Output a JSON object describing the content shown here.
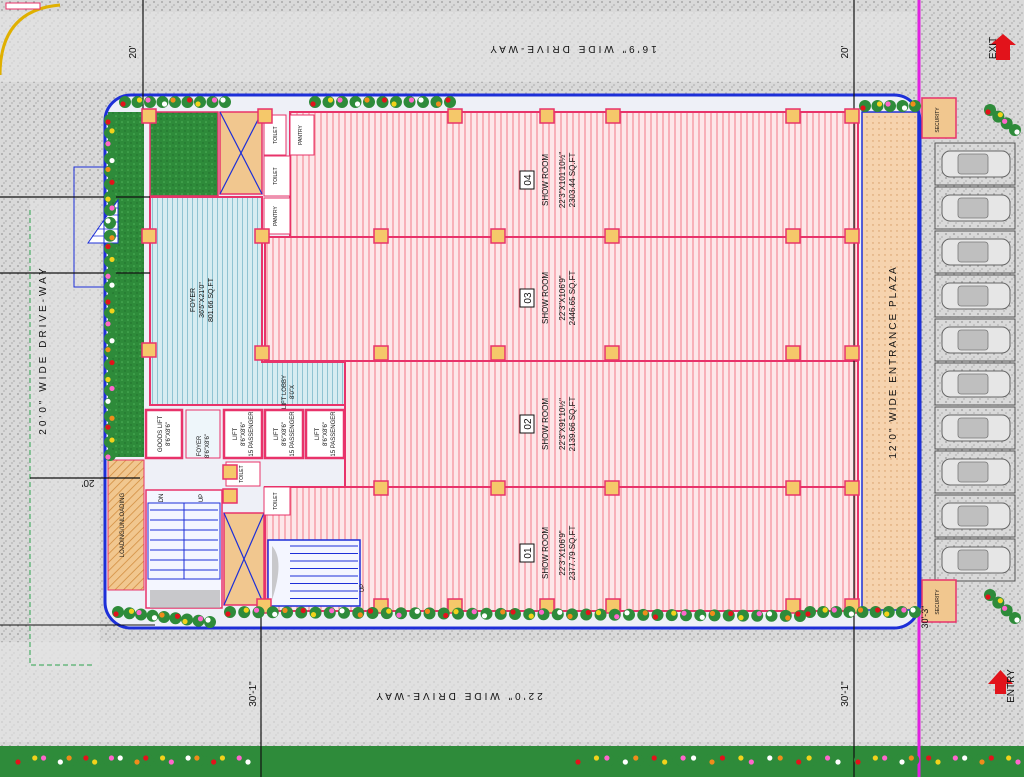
{
  "drive_way_top": "16'9\" WIDE DRIVE-WAY",
  "drive_way_bottom": "22'0\" WIDE DRIVE-WAY",
  "drive_way_left": "20'0\" WIDE DRIVE-WAY",
  "plaza": "12'0\" WIDE ENTRANCE PLAZA",
  "exit": "EXIT",
  "entry": "ENTRY",
  "dims": {
    "top_left": "20'",
    "top_right": "20'",
    "left_mid": "20'",
    "bottom_left": "30'-1\"",
    "bottom_right": "30'-1\"",
    "bottom_far_right": "30'-3\""
  },
  "showrooms": [
    {
      "num": "04",
      "name": "SHOW ROOM",
      "size": "22'3\"X101'10½\"",
      "area": "2303.44 SQ.FT"
    },
    {
      "num": "03",
      "name": "SHOW ROOM",
      "size": "22'3\"X106'9\"",
      "area": "2446.65 SQ.FT"
    },
    {
      "num": "02",
      "name": "SHOW ROOM",
      "size": "22'3\"X91'10½\"",
      "area": "2139.66 SQ.FT"
    },
    {
      "num": "01",
      "name": "SHOW ROOM",
      "size": "22'3\"X106'9\"",
      "area": "2377.79 SQ.FT"
    }
  ],
  "foyer": {
    "name": "FOYER",
    "size": "36'5\"X21'0\"",
    "area": "801.66 SQ.FT"
  },
  "foyer_small": {
    "name": "FOYER",
    "size": "8'6\"X8'6\""
  },
  "lift_lobby": {
    "name": "LIFT LOBBY",
    "size": "8'0\"X"
  },
  "goods_lift": {
    "name": "GOODS LIFT",
    "size": "8'6\"X8'6\""
  },
  "lifts": [
    {
      "name": "LIFT",
      "size": "8'6\"X8'6\"",
      "cap": "15 PASSENGER"
    },
    {
      "name": "LIFT",
      "size": "8'6\"X8'6\"",
      "cap": "15 PASSENGER"
    },
    {
      "name": "LIFT",
      "size": "8'6\"X8'6\"",
      "cap": "15 PASSENGER"
    }
  ],
  "loading": "LOADING/UNLOADING",
  "security_top": "SECURITY",
  "security_bottom": "SECURITY",
  "toilet": "TOILET",
  "pantry": "PANTRY",
  "stair_up": "UP",
  "stair_dn": "DN",
  "colors": {
    "wall": "#e8336a",
    "outline": "#1d2fd8",
    "plaza": "#f2c79a",
    "stair": "#4a6ef2",
    "green": "#2f8a3c",
    "column": "#f5c86a",
    "foyer": "#b9dbe6",
    "magenta": "#e022e0",
    "arrow": "#e2131b"
  }
}
